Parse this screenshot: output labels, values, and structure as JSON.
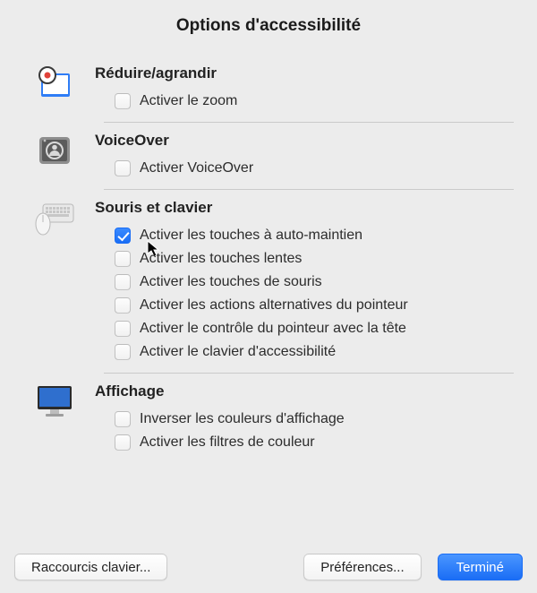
{
  "title": "Options d'accessibilité",
  "sections": {
    "zoom": {
      "title": "Réduire/agrandir",
      "items": [
        {
          "label": "Activer le zoom",
          "checked": false
        }
      ]
    },
    "voiceover": {
      "title": "VoiceOver",
      "items": [
        {
          "label": "Activer VoiceOver",
          "checked": false
        }
      ]
    },
    "mouse_keyboard": {
      "title": "Souris et clavier",
      "items": [
        {
          "label": "Activer les touches à auto-maintien",
          "checked": true
        },
        {
          "label": "Activer les touches lentes",
          "checked": false
        },
        {
          "label": "Activer les touches de souris",
          "checked": false
        },
        {
          "label": "Activer les actions alternatives du pointeur",
          "checked": false
        },
        {
          "label": "Activer le contrôle du pointeur avec la tête",
          "checked": false
        },
        {
          "label": "Activer le clavier d'accessibilité",
          "checked": false
        }
      ]
    },
    "display": {
      "title": "Affichage",
      "items": [
        {
          "label": "Inverser les couleurs d'affichage",
          "checked": false
        },
        {
          "label": "Activer les filtres de couleur",
          "checked": false
        }
      ]
    }
  },
  "footer": {
    "shortcuts": "Raccourcis clavier...",
    "prefs": "Préférences...",
    "done": "Terminé"
  }
}
